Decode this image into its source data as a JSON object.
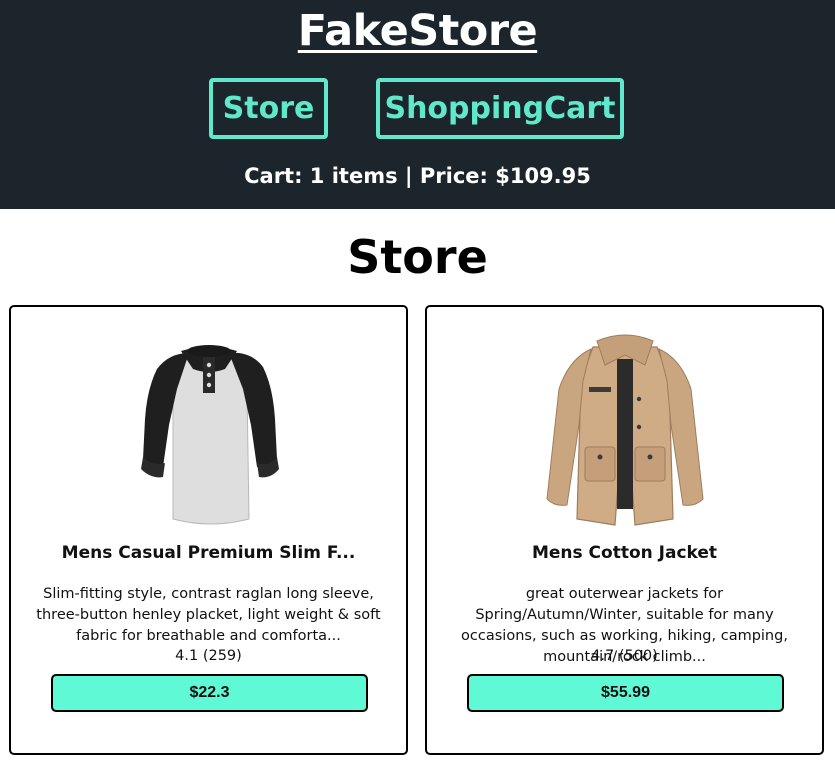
{
  "header": {
    "brand": "FakeStore",
    "nav": [
      {
        "label": "Store"
      },
      {
        "label": "ShoppingCart"
      }
    ],
    "cart_summary": "Cart: 1 items | Price: $109.95"
  },
  "main": {
    "title": "Store",
    "products": [
      {
        "title": "Mens Casual Premium Slim F...",
        "description": "Slim-fitting style, contrast raglan long sleeve, three-button henley placket, light weight & soft fabric for breathable and comforta...",
        "rating": "4.1 (259)",
        "price": "$22.3",
        "image": "raglan-henley-shirt-icon"
      },
      {
        "title": "Mens Cotton Jacket",
        "description": "great outerwear jackets for Spring/Autumn/Winter, suitable for many occasions, such as working, hiking, camping, mountain/rock climb...",
        "rating": "4.7 (500)",
        "price": "$55.99",
        "image": "cotton-jacket-icon"
      }
    ]
  },
  "colors": {
    "header_bg": "#1b252b",
    "accent": "#5fe8c9",
    "button_bg": "#5ff9d5"
  }
}
